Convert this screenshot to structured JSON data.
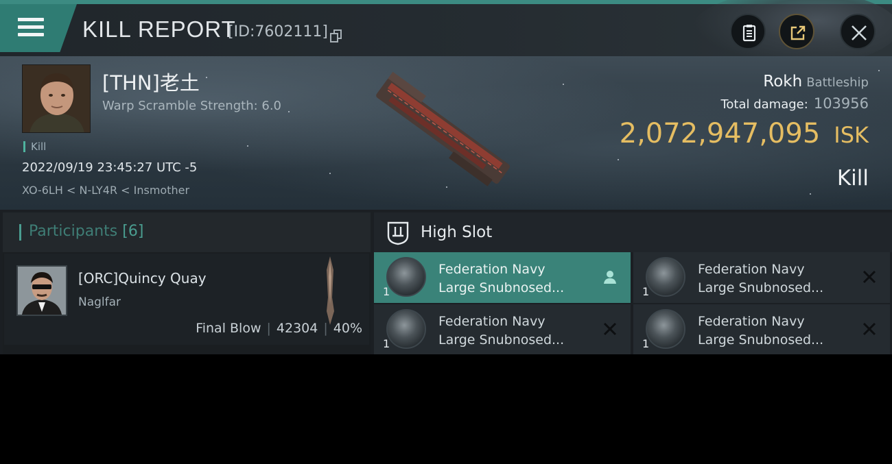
{
  "header": {
    "title": "KILL REPORT",
    "report_id": "[ID:7602111]"
  },
  "victim": {
    "name": "[THN]老土",
    "warp_scramble": "Warp Scramble Strength: 6.0",
    "tag": "Kill",
    "datetime": "2022/09/19 23:45:27 UTC -5",
    "location": "XO-6LH < N-LY4R < Insmother",
    "ship_name": "Rokh",
    "ship_class": "Battleship",
    "total_damage_label": "Total damage:",
    "total_damage": "103956",
    "isk_value": "2,072,947,095",
    "isk_unit": "ISK",
    "result": "Kill"
  },
  "participants": {
    "title": "Participants",
    "count": "[6]",
    "items": [
      {
        "name": "[ORC]Quincy Quay",
        "ship": "Naglfar",
        "role": "Final Blow",
        "damage": "42304",
        "percent": "40%"
      }
    ]
  },
  "high_slot": {
    "title": "High Slot",
    "modules": [
      {
        "line1": "Federation Navy",
        "line2": "Large Snubnosed...",
        "qty": "1",
        "flag": "user-icon",
        "selected": true
      },
      {
        "line1": "Federation Navy",
        "line2": "Large Snubnosed...",
        "qty": "1",
        "flag": "destroyed-x-icon",
        "selected": false
      },
      {
        "line1": "Federation Navy",
        "line2": "Large Snubnosed...",
        "qty": "1",
        "flag": "destroyed-x-icon",
        "selected": false
      },
      {
        "line1": "Federation Navy",
        "line2": "Large Snubnosed...",
        "qty": "1",
        "flag": "destroyed-x-icon",
        "selected": false
      }
    ]
  },
  "colors": {
    "accent": "#3a8379",
    "isk": "#e5bd62",
    "background": "#1b1f23"
  }
}
